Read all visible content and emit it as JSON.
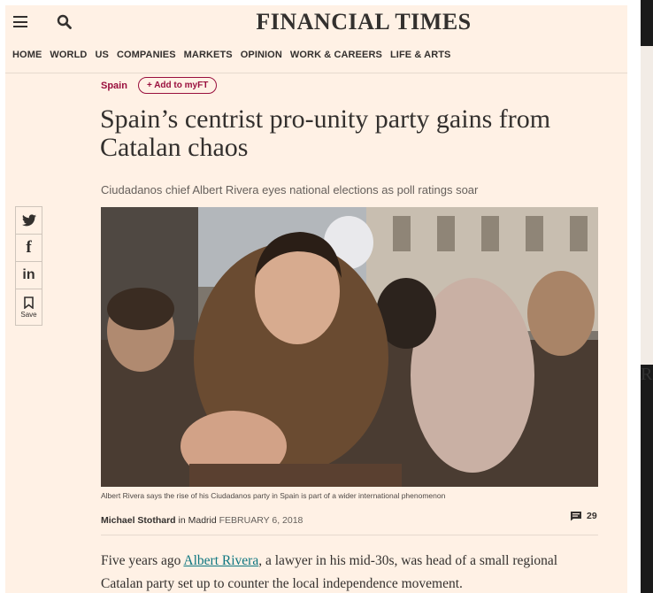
{
  "header": {
    "brand": "FINANCIAL TIMES",
    "nav": [
      "HOME",
      "WORLD",
      "US",
      "COMPANIES",
      "MARKETS",
      "OPINION",
      "WORK & CAREERS",
      "LIFE & ARTS"
    ]
  },
  "article": {
    "topic": "Spain",
    "add_myft": "+ Add to myFT",
    "headline": "Spain’s centrist pro-unity party gains from Catalan chaos",
    "standfirst": "Ciudadanos chief Albert Rivera eyes national elections as poll ratings soar",
    "caption": "Albert Rivera says the rise of his Ciudadanos party in Spain is part of a wider international phenomenon",
    "author": "Michael Stothard",
    "location": "in Madrid",
    "date": "FEBRUARY 6, 2018",
    "comment_count": "29",
    "body_before_link": "Five years ago ",
    "body_link": "Albert Rivera",
    "body_after_link": ", a lawyer in his mid-30s, was head of a small regional Catalan party set up to counter the local independence movement."
  },
  "share": {
    "save_label": "Save",
    "icons": [
      "twitter-icon",
      "facebook-icon",
      "linkedin-icon",
      "bookmark-icon"
    ]
  },
  "colors": {
    "page_bg": "#fff1e5",
    "accent": "#990f3d",
    "link": "#0d7680",
    "text": "#33302e"
  }
}
